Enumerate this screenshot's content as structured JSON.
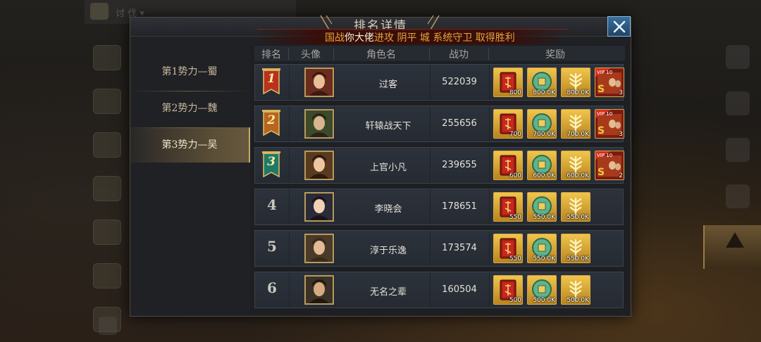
{
  "background": {
    "topbar_text": "讨 伐  ▾",
    "right_labels": [
      "",
      "",
      "",
      ""
    ],
    "gold_label": "",
    "bottom_text_1": "",
    "bottom_text_2": ""
  },
  "dialog": {
    "title": "排名详情",
    "ticker": {
      "prefix": "国战",
      "highlight": "你大佬",
      "suffix": "进攻 阴平 城 系统守卫 取得胜利"
    }
  },
  "tabs": [
    {
      "label": "第1势力—蜀",
      "active": false
    },
    {
      "label": "第2势力—魏",
      "active": false
    },
    {
      "label": "第3势力—吴",
      "active": true
    }
  ],
  "table": {
    "headers": {
      "rank": "排名",
      "avatar": "头像",
      "name": "角色名",
      "power": "战功",
      "reward": "奖励"
    },
    "rows": [
      {
        "rank": "1",
        "banner_color": "#b8321e",
        "name": "过客",
        "power": "522039",
        "rewards": [
          "800",
          "800.0K",
          "800.0K",
          "3"
        ],
        "vip": true
      },
      {
        "rank": "2",
        "banner_color": "#b8651e",
        "name": "轩辕战天下",
        "power": "255656",
        "rewards": [
          "700",
          "700.0K",
          "700.0K",
          "3"
        ],
        "vip": true
      },
      {
        "rank": "3",
        "banner_color": "#1e7a66",
        "name": "上官小凡",
        "power": "239655",
        "rewards": [
          "600",
          "600.0K",
          "600.0K",
          "2"
        ],
        "vip": true
      },
      {
        "rank": "4",
        "banner_color": "",
        "name": "李晓会",
        "power": "178651",
        "rewards": [
          "550",
          "550.0K",
          "550.0K"
        ],
        "vip": false
      },
      {
        "rank": "5",
        "banner_color": "",
        "name": "淳于乐逸",
        "power": "173574",
        "rewards": [
          "550",
          "550.0K",
          "550.0K"
        ],
        "vip": false
      },
      {
        "rank": "6",
        "banner_color": "",
        "name": "无名之辈",
        "power": "160504",
        "rewards": [
          "500",
          "500.0K",
          "500.0K"
        ],
        "vip": false
      }
    ],
    "reward_icons": [
      "red-book-icon",
      "copper-coin-icon",
      "wheat-icon",
      "vip-card-icon"
    ],
    "vip_badge": "VIP 10"
  }
}
